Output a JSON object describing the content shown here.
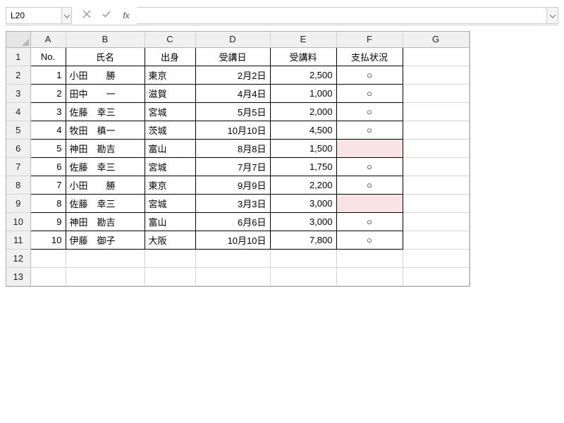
{
  "formula_bar": {
    "name_box": "L20",
    "fx_label": "fx",
    "input": ""
  },
  "columns": [
    "A",
    "B",
    "C",
    "D",
    "E",
    "F",
    "G"
  ],
  "row_numbers": [
    1,
    2,
    3,
    4,
    5,
    6,
    7,
    8,
    9,
    10,
    11,
    12,
    13
  ],
  "headers": {
    "no": "No.",
    "name": "氏名",
    "origin": "出身",
    "date": "受講日",
    "fee": "受講料",
    "status": "支払状況"
  },
  "rows": [
    {
      "no": "1",
      "name": "小田　　勝",
      "origin": "東京",
      "date": "2月2日",
      "fee": "2,500",
      "status": "○",
      "highlight": false
    },
    {
      "no": "2",
      "name": "田中　　一",
      "origin": "滋賀",
      "date": "4月4日",
      "fee": "1,000",
      "status": "○",
      "highlight": false
    },
    {
      "no": "3",
      "name": "佐藤　幸三",
      "origin": "宮城",
      "date": "5月5日",
      "fee": "2,000",
      "status": "○",
      "highlight": false
    },
    {
      "no": "4",
      "name": "牧田　槙一",
      "origin": "茨城",
      "date": "10月10日",
      "fee": "4,500",
      "status": "○",
      "highlight": false
    },
    {
      "no": "5",
      "name": "神田　勘吉",
      "origin": "富山",
      "date": "8月8日",
      "fee": "1,500",
      "status": "",
      "highlight": true
    },
    {
      "no": "6",
      "name": "佐藤　幸三",
      "origin": "宮城",
      "date": "7月7日",
      "fee": "1,750",
      "status": "○",
      "highlight": false
    },
    {
      "no": "7",
      "name": "小田　　勝",
      "origin": "東京",
      "date": "9月9日",
      "fee": "2,200",
      "status": "○",
      "highlight": false
    },
    {
      "no": "8",
      "name": "佐藤　幸三",
      "origin": "宮城",
      "date": "3月3日",
      "fee": "3,000",
      "status": "",
      "highlight": true
    },
    {
      "no": "9",
      "name": "神田　勘吉",
      "origin": "富山",
      "date": "6月6日",
      "fee": "3,000",
      "status": "○",
      "highlight": false
    },
    {
      "no": "10",
      "name": "伊藤　御子",
      "origin": "大阪",
      "date": "10月10日",
      "fee": "7,800",
      "status": "○",
      "highlight": false
    }
  ],
  "chart_data": {
    "type": "table",
    "columns": [
      "No.",
      "氏名",
      "出身",
      "受講日",
      "受講料",
      "支払状況"
    ],
    "rows": [
      [
        1,
        "小田　勝",
        "東京",
        "2月2日",
        2500,
        "○"
      ],
      [
        2,
        "田中　一",
        "滋賀",
        "4月4日",
        1000,
        "○"
      ],
      [
        3,
        "佐藤　幸三",
        "宮城",
        "5月5日",
        2000,
        "○"
      ],
      [
        4,
        "牧田　槙一",
        "茨城",
        "10月10日",
        4500,
        "○"
      ],
      [
        5,
        "神田　勘吉",
        "富山",
        "8月8日",
        1500,
        ""
      ],
      [
        6,
        "佐藤　幸三",
        "宮城",
        "7月7日",
        1750,
        "○"
      ],
      [
        7,
        "小田　勝",
        "東京",
        "9月9日",
        2200,
        "○"
      ],
      [
        8,
        "佐藤　幸三",
        "宮城",
        "3月3日",
        3000,
        ""
      ],
      [
        9,
        "神田　勘吉",
        "富山",
        "6月6日",
        3000,
        "○"
      ],
      [
        10,
        "伊藤　御子",
        "大阪",
        "10月10日",
        7800,
        "○"
      ]
    ]
  }
}
